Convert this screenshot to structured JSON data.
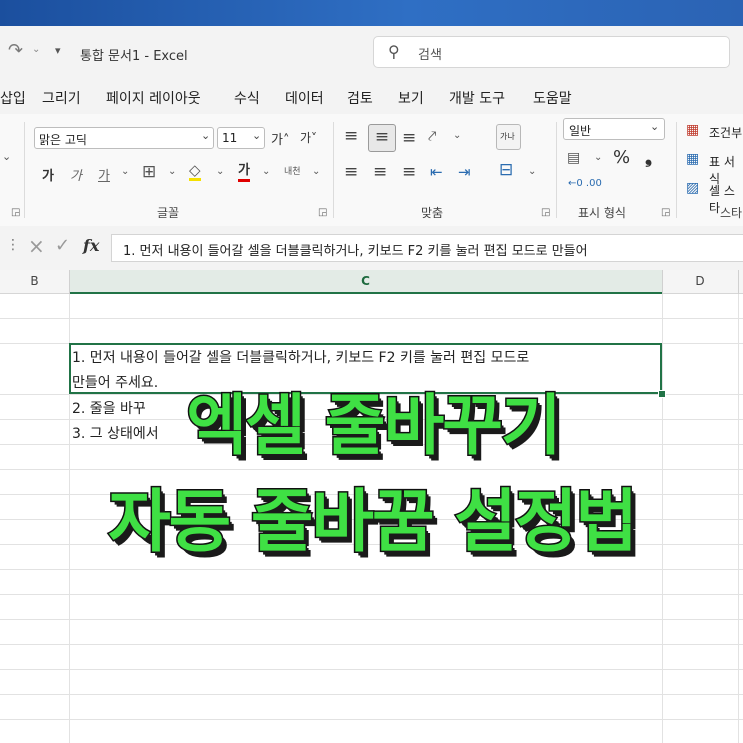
{
  "titlebar": {
    "title": "통합 문서1  -  Excel",
    "search_placeholder": "검색"
  },
  "menu": [
    "삽입",
    "그리기",
    "페이지 레이아웃",
    "수식",
    "데이터",
    "검토",
    "보기",
    "개발 도구",
    "도움말"
  ],
  "ribbon": {
    "font_name": "맑은 고딕",
    "font_size": "11",
    "grow_font": "가˄",
    "shrink_font": "가˅",
    "bold": "가",
    "italic": "가",
    "underline": "가",
    "font_color": "가",
    "phonetic": "내천",
    "wrap": "가나",
    "number_format": "일반",
    "percent": "%",
    "comma": "❟",
    "cond_format": "조건부",
    "table_format": "표 서식",
    "cell_styles": "셀 스타",
    "group_font": "글꼴",
    "group_align": "맞춤",
    "group_number": "표시 형식",
    "group_styles": "스타"
  },
  "formula_bar": {
    "fx": "fx",
    "content": "1.  먼저 내용이 들어갈 셀을 더블클릭하거나, 키보드 F2 키를 눌러 편집 모드로 만들어"
  },
  "columns": [
    "B",
    "C",
    "D"
  ],
  "cells": {
    "c1_line1": "1.  먼저 내용이 들어갈 셀을 더블클릭하거나, 키보드 F2 키를 눌러 편집 모드로",
    "c1_line2": "만들어 주세요.",
    "c2": "2.  줄을 바꾸",
    "c3": "3.  그 상태에서"
  },
  "overlay": {
    "line1": "엑셀 줄바꾸기",
    "line2": "자동 줄바꿈 설정법"
  },
  "colors": {
    "accent": "#217346",
    "headline_green": "#3fe044"
  }
}
